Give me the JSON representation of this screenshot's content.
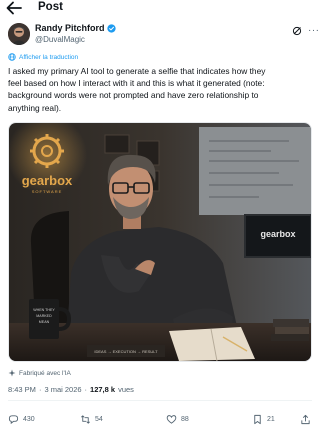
{
  "header": {
    "title": "Post"
  },
  "author": {
    "name": "Randy Pitchford",
    "handle": "@DuvalMagic"
  },
  "translate": {
    "label": "Afficher la traduction"
  },
  "tweet": {
    "lines": [
      "I asked my primary AI tool to generate a selfie that indicates how they",
      "feel based on how I interact with it and this is what it generated (note:",
      "background words were not prompted and have zero relationship to",
      "anything real)."
    ]
  },
  "image": {
    "sign_text": "gearbox",
    "sign_sub": "SOFTWARE",
    "screen_text": "gearbox",
    "mug_text": "WHEN\nTHEY\nMARKED\nMEAN\nWORLD",
    "board_text": "IDEAS → EXECUTION → RESULT"
  },
  "ai_label": "Fabriqué avec l'IA",
  "meta": {
    "time": "8:43 PM",
    "date": "3 mai 2026",
    "views": "127,8 k",
    "views_label": "vues",
    "sep": "·"
  },
  "actions": {
    "replies": "430",
    "reposts": "54",
    "likes": "88",
    "bookmarks": "21"
  },
  "colors": {
    "accent": "#1d9bf0",
    "muted": "#536471",
    "text": "#0f1419"
  }
}
